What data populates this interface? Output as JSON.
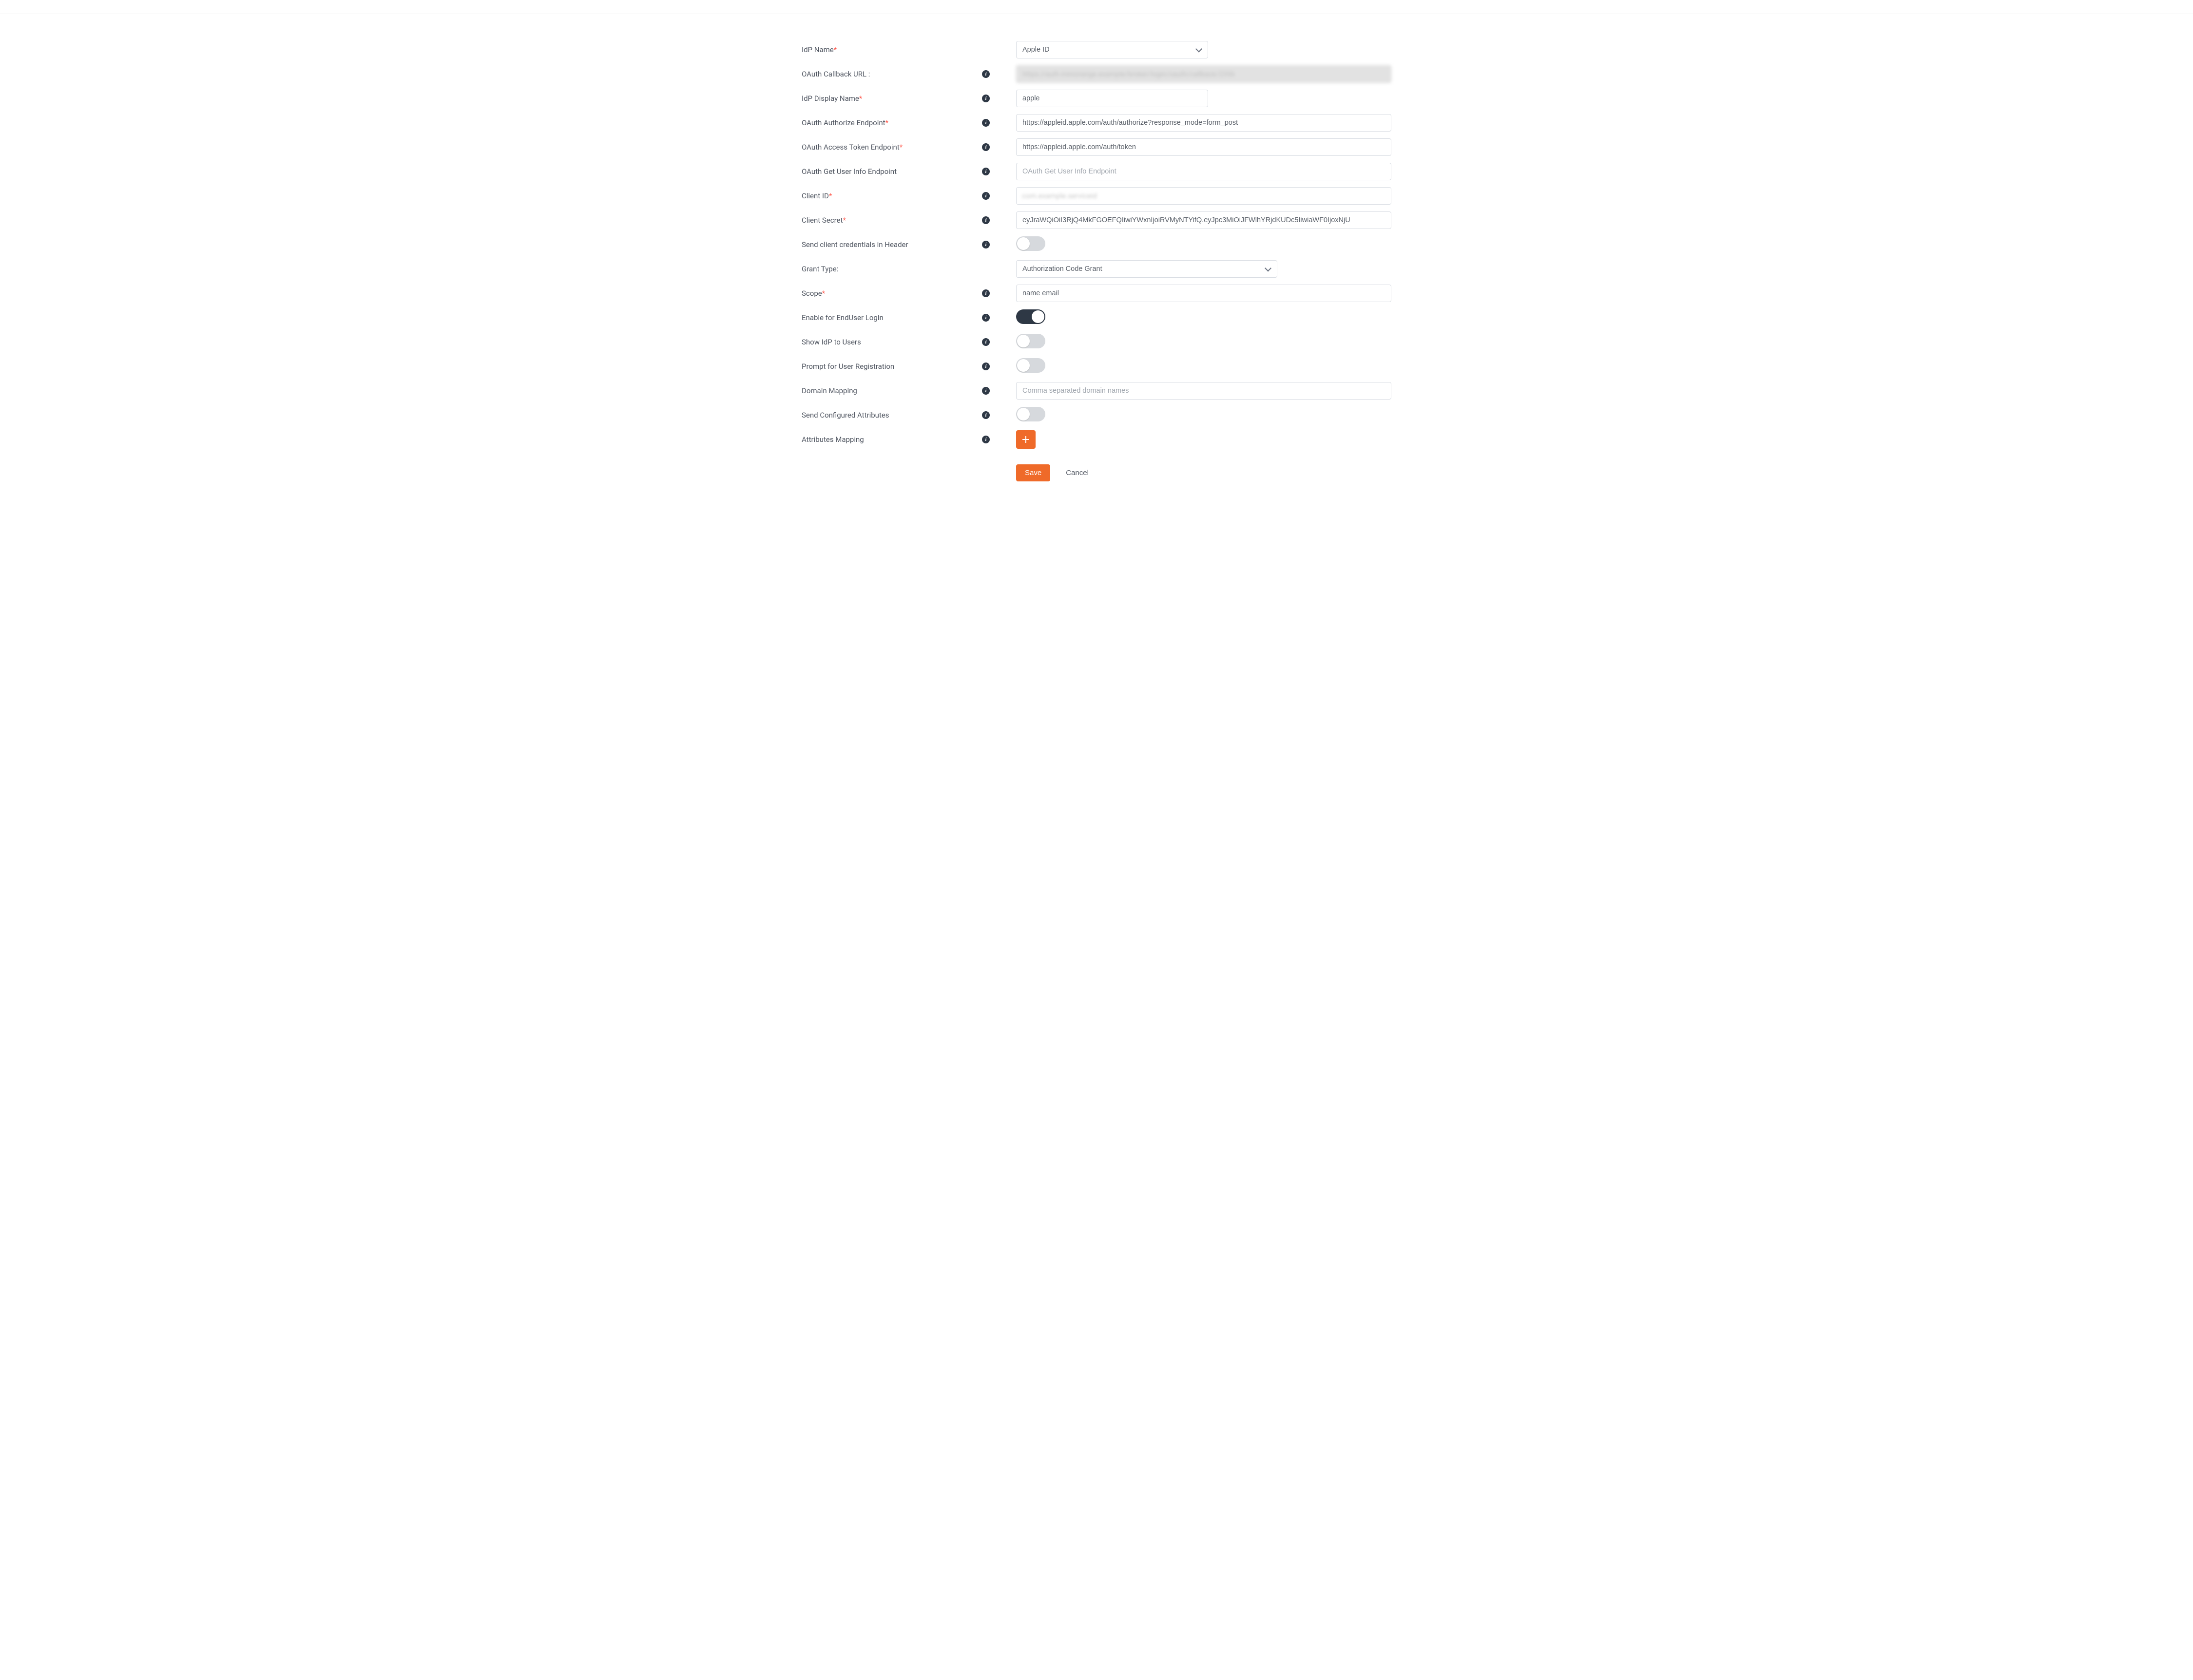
{
  "labels": {
    "idp_name": "IdP Name",
    "callback_url": "OAuth Callback URL :",
    "display_name": "IdP Display Name",
    "authorize_ep": "OAuth Authorize Endpoint",
    "token_ep": "OAuth Access Token Endpoint",
    "userinfo_ep": "OAuth Get User Info Endpoint",
    "client_id": "Client ID",
    "client_secret": "Client Secret",
    "creds_header": "Send client credentials in Header",
    "grant_type": "Grant Type:",
    "scope": "Scope",
    "enduser_login": "Enable for EndUser Login",
    "show_idp": "Show IdP to Users",
    "prompt_reg": "Prompt for User Registration",
    "domain_mapping": "Domain Mapping",
    "send_attrs": "Send Configured Attributes",
    "attrs_mapping": "Attributes Mapping"
  },
  "required_marker": "*",
  "idp_name_options": [
    "Apple ID"
  ],
  "idp_name_value": "Apple ID",
  "callback_url_masked": "https://auth.miniorange.example/broker/login/oauth/callback/2356",
  "display_name_value": "apple",
  "authorize_ep_value": "https://appleid.apple.com/auth/authorize?response_mode=form_post",
  "token_ep_value": "https://appleid.apple.com/auth/token",
  "userinfo_ep_value": "",
  "userinfo_ep_placeholder": "OAuth Get User Info Endpoint",
  "client_id_masked": "com.example.serviceid",
  "client_secret_value": "eyJraWQiOiI3RjQ4MkFGOEFQIiwiYWxnIjoiRVMyNTYifQ.eyJpc3MiOiJFWlhYRjdKUDc5IiwiaWF0IjoxNjU",
  "grant_type_options": [
    "Authorization Code Grant"
  ],
  "grant_type_value": "Authorization Code Grant",
  "scope_value": "name email",
  "domain_mapping_value": "",
  "domain_mapping_placeholder": "Comma separated domain names",
  "toggles": {
    "creds_header": false,
    "enduser_login": true,
    "show_idp": false,
    "prompt_reg": false,
    "send_attrs": false
  },
  "buttons": {
    "save": "Save",
    "cancel": "Cancel"
  },
  "info_glyph": "i"
}
